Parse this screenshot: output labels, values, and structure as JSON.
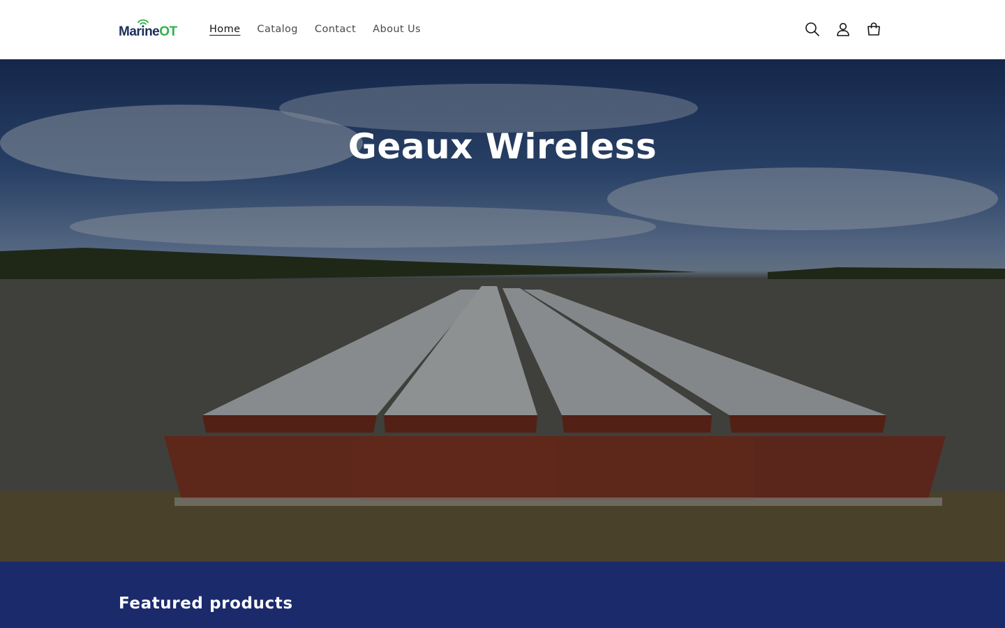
{
  "header": {
    "logo": {
      "part1": "Marine",
      "part2": "OT"
    },
    "nav": [
      {
        "label": "Home"
      },
      {
        "label": "Catalog"
      },
      {
        "label": "Contact"
      },
      {
        "label": "About Us"
      }
    ],
    "icons": [
      "search-icon",
      "account-icon",
      "cart-icon"
    ]
  },
  "hero": {
    "title": "Geaux Wireless"
  },
  "featured": {
    "title": "Featured products"
  },
  "colors": {
    "brand_navy": "#1b2e5a",
    "brand_green": "#2fb24a",
    "featured_bg": "#1b2a6b"
  }
}
